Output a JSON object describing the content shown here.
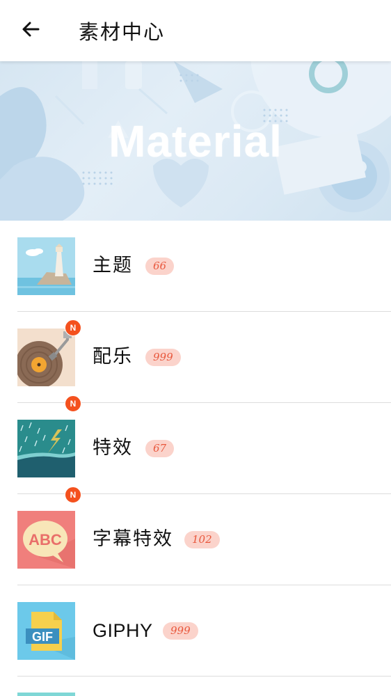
{
  "header": {
    "back_icon": "arrow-left-icon",
    "title": "素材中心"
  },
  "banner": {
    "title": "Material",
    "colors": {
      "base": "#d6e6f2",
      "shape": "#c3dbed"
    }
  },
  "materials": [
    {
      "label": "主题",
      "count": "66",
      "is_new": false,
      "icon": "lighthouse-theme-icon"
    },
    {
      "label": "配乐",
      "count": "999",
      "is_new": true,
      "new_badge": "N",
      "icon": "vinyl-record-music-icon"
    },
    {
      "label": "特效",
      "count": "67",
      "is_new": true,
      "new_badge": "N",
      "icon": "rain-lightning-effect-icon"
    },
    {
      "label": "字幕特效",
      "count": "102",
      "is_new": true,
      "new_badge": "N",
      "icon": "abc-speech-bubble-subtitle-icon"
    },
    {
      "label": "GIPHY",
      "count": "999",
      "is_new": false,
      "icon": "gif-file-icon"
    }
  ],
  "colors": {
    "count_pill_bg": "#fbd3cb",
    "count_pill_text": "#e8573c",
    "new_badge": "#f4511e"
  }
}
